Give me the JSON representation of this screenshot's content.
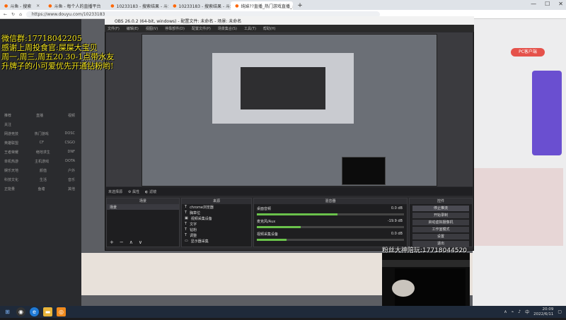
{
  "browser": {
    "tabs": [
      {
        "label": "斗鱼 - 搜索"
      },
      {
        "label": "斗鱼 - 每个人的直播平台"
      },
      {
        "label": "10233183 - 搜索结果 - 斗鱼直播"
      },
      {
        "label": "10233183 - 搜索结果 - 斗鱼直播"
      },
      {
        "label": "纯妹??直播_热门游戏直播_斗鱼"
      }
    ],
    "url": "https://www.douyu.com/10233183",
    "add_tab": "+"
  },
  "overlay_text": {
    "line1": "微信群:17718042205",
    "line2": "感谢上周投食官:屎屎大宝贝",
    "line3": "周一,周三,周五20.30-1点带水友",
    "line4": "升牌子的小可爱优先开通钻粉哟!"
  },
  "page": {
    "pc_client_button": "PC客户端",
    "sidebar_items": [
      [
        "推荐",
        "直播",
        "视频"
      ],
      [
        "关注",
        "",
        ""
      ],
      [
        "网游竞技",
        "热门游戏",
        "DOSC"
      ],
      [
        "英雄联盟",
        "CF",
        "CSGO"
      ],
      [
        "王者荣耀",
        "绝地求生",
        "DNF"
      ],
      [
        "单机热游",
        "主机游戏",
        "DOTA"
      ],
      [
        "娱乐天地",
        "颜值",
        "户外"
      ],
      [
        "科技文化",
        "生活",
        "音乐"
      ],
      [
        "正能量",
        "鱼塘",
        "其他"
      ]
    ]
  },
  "obs": {
    "title": "OBS 26.0.2 (64-bit, windows) - 配置文件: 未命名 - 场景: 未命名",
    "menu": [
      "文件(F)",
      "编辑(E)",
      "视图(V)",
      "停靠部件(D)",
      "配置文件(P)",
      "场景集合(S)",
      "工具(T)",
      "帮助(H)"
    ],
    "status_label": "未选择源",
    "status_props": "属性",
    "status_filters": "滤镜",
    "docks": {
      "scenes": "场景",
      "sources": "来源",
      "mixer": "混音器",
      "controls": "控件"
    },
    "scene_items": [
      "场景"
    ],
    "source_items": [
      "chrome浏览器",
      "胸章位",
      "视频采集设备",
      "文字",
      "钻粉",
      "调整",
      "显示器采集"
    ],
    "mixer_items": [
      {
        "name": "桌面音频",
        "db": "0.0 dB",
        "level": 0.55
      },
      {
        "name": "麦克风/Aux",
        "db": "-19.9 dB",
        "level": 0.3
      },
      {
        "name": "视频采集设备",
        "db": "0.0 dB",
        "level": 0.2
      }
    ],
    "control_buttons": [
      "停止推流",
      "开始录制",
      "启动虚拟摄像机",
      "工作室模式",
      "设置",
      "退出"
    ],
    "stats": "LIVE: 00:12:34  REC: 00:00:00  CPU: 5.0%, 30.00 fps"
  },
  "camera_label": "粉丝大神陪玩:17718044520",
  "taskbar": {
    "time": "20:09",
    "date": "2022/6/11",
    "lang": "中"
  },
  "colors": {
    "overlay_yellow": "#f5e61e",
    "page_bg": "#5c5e63",
    "brand_orange": "#e5524b",
    "meter_green": "#6ac24b"
  }
}
